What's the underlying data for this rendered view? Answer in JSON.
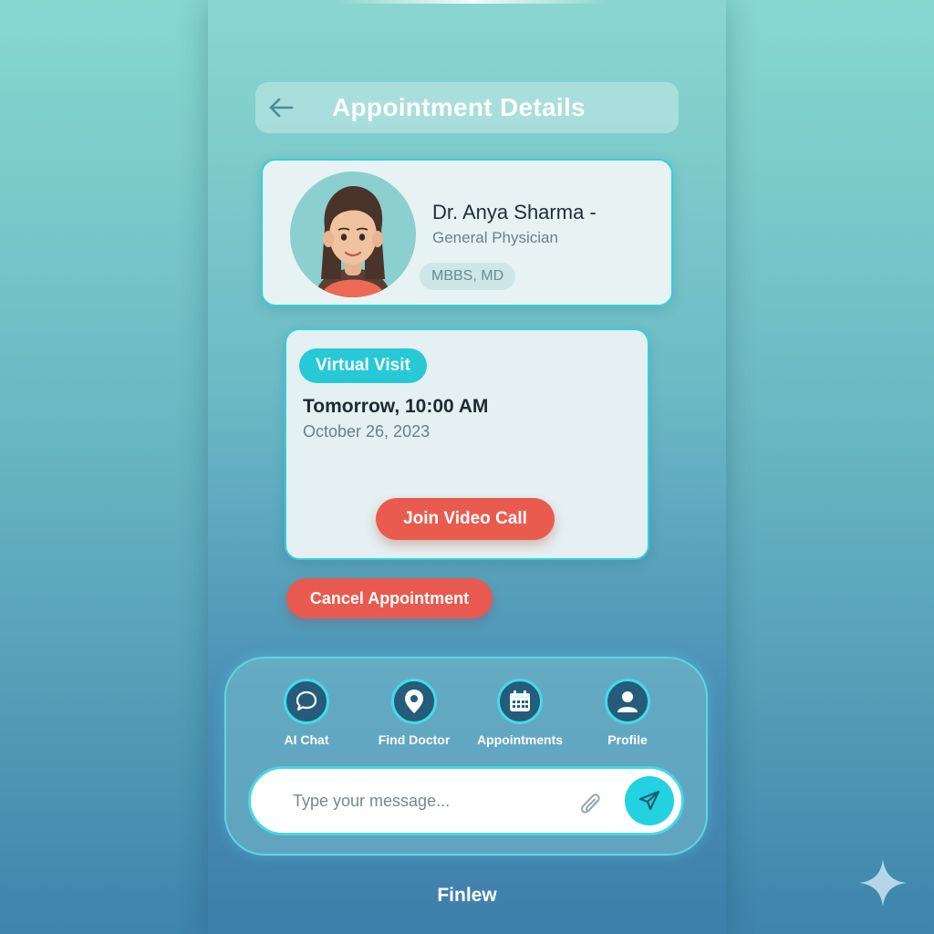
{
  "header": {
    "title": "Appointment Details"
  },
  "doctor": {
    "name": "Dr. Anya Sharma -",
    "specialty": "General Physician",
    "credentials": "MBBS, MD"
  },
  "visit": {
    "type": "Virtual Visit",
    "time": "Tomorrow, 10:00 AM",
    "date": "October 26, 2023",
    "join_label": "Join Video Call"
  },
  "actions": {
    "cancel_label": "Cancel Appointment"
  },
  "nav": {
    "items": [
      {
        "label": "AI Chat",
        "icon": "chat-bubble-icon"
      },
      {
        "label": "Find Doctor",
        "icon": "location-pin-icon"
      },
      {
        "label": "Appointments",
        "icon": "calendar-icon"
      },
      {
        "label": "Profile",
        "icon": "user-icon"
      }
    ]
  },
  "message": {
    "placeholder": "Type your message..."
  },
  "brand": {
    "name": "Finlew"
  },
  "colors": {
    "accent": "#27c9d6",
    "danger": "#ea5b4f",
    "nav_icon_bg": "#245c79"
  }
}
